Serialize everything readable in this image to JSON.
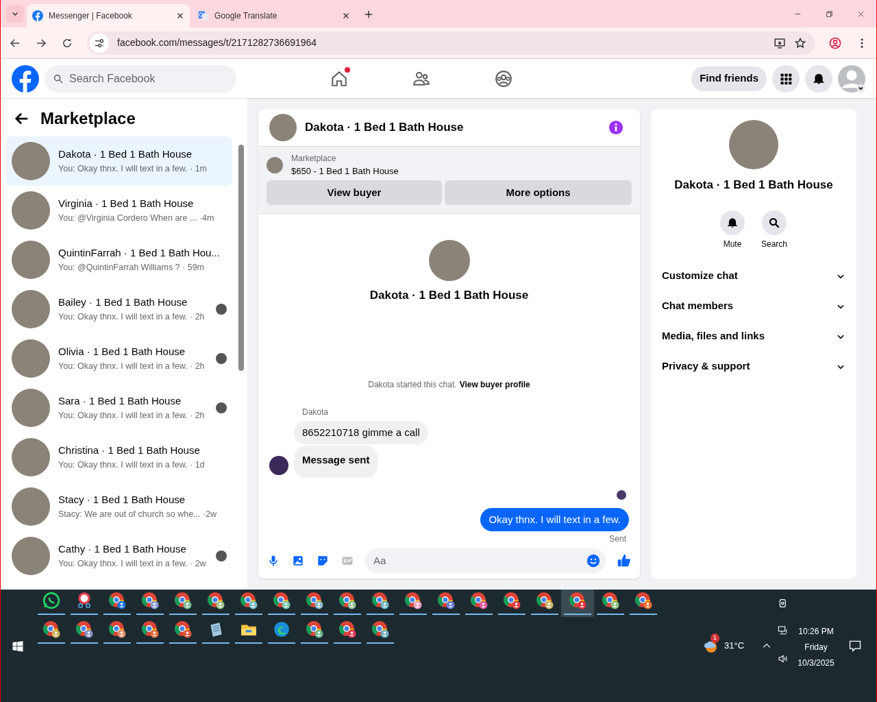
{
  "browser": {
    "tabs": [
      {
        "title": "Messenger | Facebook",
        "kind": "facebook",
        "selected": true
      },
      {
        "title": "Google Translate",
        "kind": "translate",
        "selected": false
      }
    ],
    "url": "facebook.com/messages/t/2171282736691964"
  },
  "header": {
    "search_placeholder": "Search Facebook",
    "nav": [
      {
        "kind": "home",
        "notification": true
      },
      {
        "kind": "friends",
        "notification": false
      },
      {
        "kind": "groups",
        "notification": false
      }
    ],
    "find_friends": "Find friends"
  },
  "sidebar": {
    "title": "Marketplace",
    "conversations": [
      {
        "name": "Dakota · 1 Bed 1 Bath House",
        "preview": "You: Okay thnx. I will text in a few. · 1m",
        "selected": true,
        "seen": false
      },
      {
        "name": "Virginia · 1 Bed 1 Bath House",
        "preview": "You: @Virginia Cordero When are ... ·4m",
        "selected": false,
        "seen": false
      },
      {
        "name": "QuintinFarrah · 1 Bed 1 Bath Hou...",
        "preview": "You: @QuintinFarrah Williams ? · 59m",
        "selected": false,
        "seen": false
      },
      {
        "name": "Bailey · 1 Bed 1 Bath House",
        "preview": "You: Okay thnx. I will text in a few. · 2h",
        "selected": false,
        "seen": true
      },
      {
        "name": "Olivia · 1 Bed 1 Bath House",
        "preview": "You: Okay thnx. I will text in a few. · 2h",
        "selected": false,
        "seen": true
      },
      {
        "name": "Sara · 1 Bed 1 Bath House",
        "preview": "You: Okay thnx. I will text in a few. · 2h",
        "selected": false,
        "seen": true
      },
      {
        "name": "Christina · 1 Bed 1 Bath House",
        "preview": "You: Okay thnx. I will text in a few. · 1d",
        "selected": false,
        "seen": false
      },
      {
        "name": "Stacy · 1 Bed 1 Bath House",
        "preview": "Stacy: We are out of church so whe... ·2w",
        "selected": false,
        "seen": false
      },
      {
        "name": "Cathy · 1 Bed 1 Bath House",
        "preview": "You: Okay thnx. I will text in a few. · 2w",
        "selected": false,
        "seen": true
      }
    ]
  },
  "chat": {
    "title": "Dakota · 1 Bed 1 Bath House",
    "listing": {
      "label": "Marketplace",
      "price_title": "$650 - 1 Bed 1 Bath House"
    },
    "buttons": [
      "View buyer",
      "More options"
    ],
    "intro_name": "Dakota · 1 Bed 1 Bath House",
    "started": "Dakota started this chat.",
    "profile_link": "View buyer profile",
    "sender": "Dakota",
    "messages": [
      {
        "text": "8652210718 gimme a call",
        "kind": "incoming"
      },
      {
        "text": "Message sent",
        "kind": "incoming-bold"
      },
      {
        "text": "Okay thnx. I will text in a few.",
        "kind": "outgoing"
      }
    ],
    "status": "Sent",
    "composer_placeholder": "Aa"
  },
  "details": {
    "name": "Dakota · 1 Bed 1 Bath House",
    "actions": [
      {
        "label": "Mute",
        "kind": "bell"
      },
      {
        "label": "Search",
        "kind": "search"
      }
    ],
    "sections": [
      "Customize chat",
      "Chat members",
      "Media, files and links",
      "Privacy & support"
    ]
  },
  "taskbar": {
    "apps": [
      {
        "kind": "whatsapp",
        "selected": false
      },
      {
        "kind": "snip",
        "selected": false
      },
      {
        "kind": "chrome",
        "color": "#1a73e8",
        "selected": false
      },
      {
        "kind": "chrome",
        "color": "#8e9bd6",
        "selected": false
      },
      {
        "kind": "chrome",
        "color": "#7fbf9a",
        "selected": false
      },
      {
        "kind": "chrome",
        "color": "#9fc58a",
        "selected": false
      },
      {
        "kind": "chrome",
        "color": "#7ec0c8",
        "selected": false
      },
      {
        "kind": "chrome",
        "color": "#7fc8b0",
        "selected": false
      },
      {
        "kind": "chrome",
        "color": "#86b8c9",
        "selected": false
      },
      {
        "kind": "chrome",
        "color": "#8fc39a",
        "selected": false
      },
      {
        "kind": "chrome",
        "color": "#6fb8c8",
        "selected": false
      },
      {
        "kind": "chrome",
        "color": "#e8a0c0",
        "selected": false
      },
      {
        "kind": "chrome",
        "color": "#6b7fd6",
        "selected": false
      },
      {
        "kind": "chrome",
        "color": "#e05a9a",
        "selected": false
      },
      {
        "kind": "chrome",
        "color": "#e0404a",
        "selected": false
      },
      {
        "kind": "chrome",
        "color": "#c8b870",
        "selected": false
      },
      {
        "kind": "chrome",
        "color": "#e03040",
        "selected": true
      },
      {
        "kind": "chrome",
        "color": "#90c080",
        "selected": false
      },
      {
        "kind": "chrome",
        "color": "#f07030",
        "selected": false
      },
      {
        "kind": "chrome",
        "color": "#d0b060",
        "selected": false
      },
      {
        "kind": "chrome",
        "color": "#8a90c8",
        "selected": false
      },
      {
        "kind": "chrome",
        "color": "#e09070",
        "selected": false
      },
      {
        "kind": "chrome",
        "color": "#e07040",
        "selected": false
      },
      {
        "kind": "chrome",
        "color": "#e05a40",
        "selected": false
      },
      {
        "kind": "notepad",
        "selected": false
      },
      {
        "kind": "folder",
        "selected": false
      },
      {
        "kind": "edge",
        "selected": false
      },
      {
        "kind": "chrome",
        "color": "#70b890",
        "selected": false
      },
      {
        "kind": "chrome",
        "color": "#e03a50",
        "selected": false
      },
      {
        "kind": "chrome",
        "color": "#70b0c0",
        "selected": false
      }
    ],
    "weather": "31°C",
    "weather_badge": "1",
    "time": "10:26 PM",
    "day": "Friday",
    "date": "10/3/2025"
  }
}
